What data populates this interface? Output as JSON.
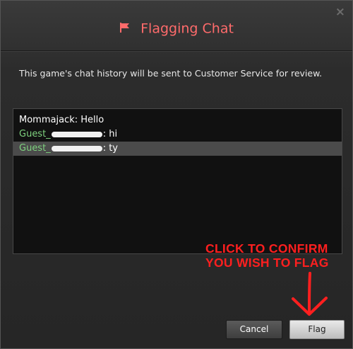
{
  "dialog": {
    "title": "Flagging Chat",
    "close_label": "×",
    "description": "This game's chat history will be sent to Customer Service for review."
  },
  "chat": {
    "lines": [
      {
        "name": "Mommajack",
        "message": ": Hello",
        "is_guest": false,
        "selected": false
      },
      {
        "name": "Guest_",
        "message": ": hi",
        "is_guest": true,
        "selected": false
      },
      {
        "name": "Guest_",
        "message": ": ty",
        "is_guest": true,
        "selected": true
      }
    ]
  },
  "annotation": {
    "line1": "CLICK TO CONFIRM",
    "line2": "YOU WISH TO FLAG"
  },
  "buttons": {
    "cancel": "Cancel",
    "flag": "Flag"
  },
  "colors": {
    "title": "#ff6b6b",
    "guest_name": "#7ed17e",
    "annotation": "#ff1f1f"
  },
  "icons": {
    "title_icon": "flag-icon",
    "close_icon": "close-icon",
    "annotation_arrow": "arrow-down-icon"
  }
}
